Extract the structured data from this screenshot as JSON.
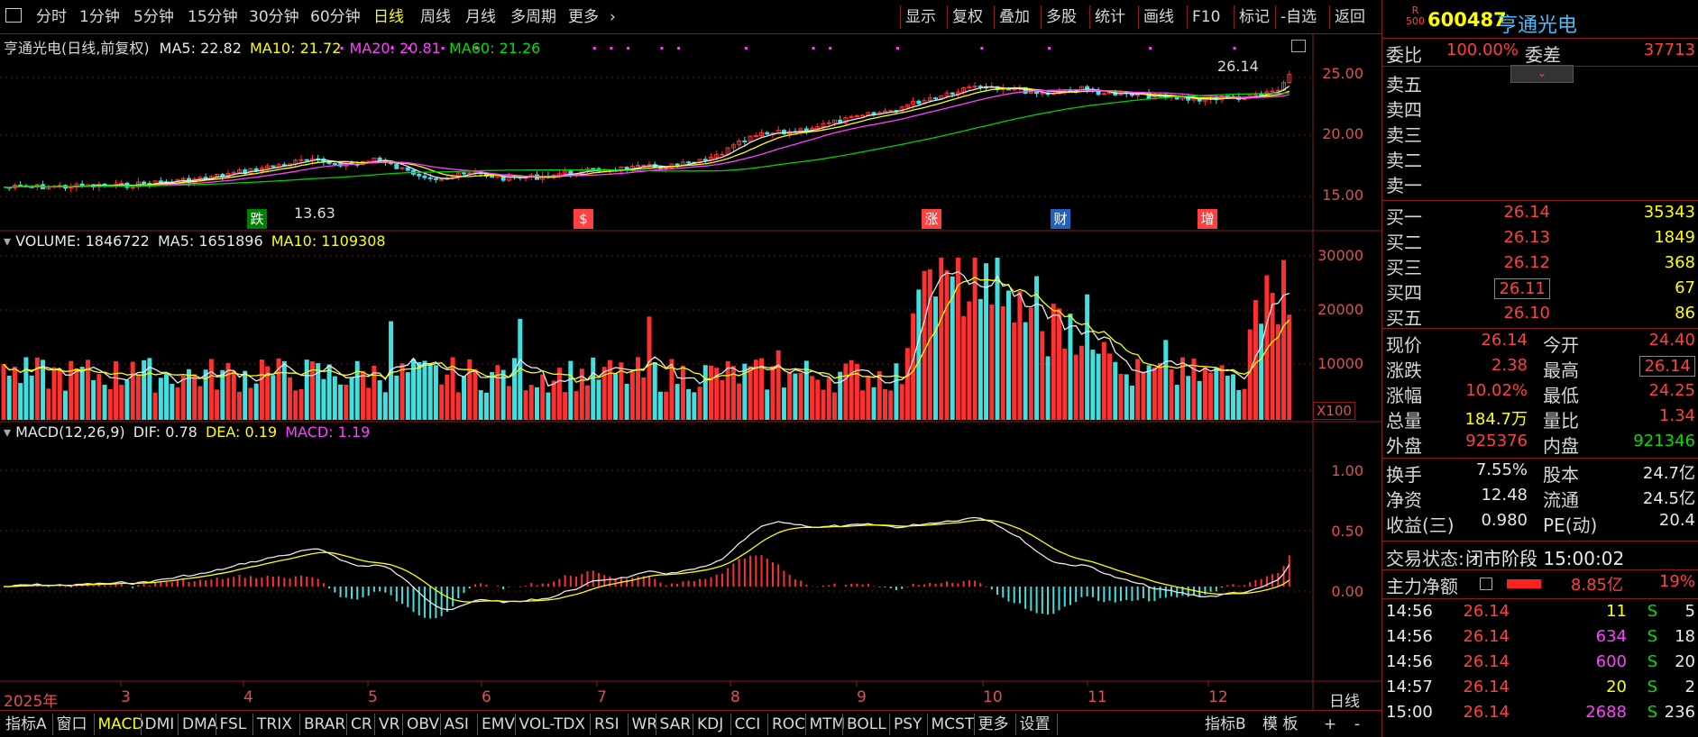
{
  "toolbar": {
    "periods": [
      "分时",
      "1分钟",
      "5分钟",
      "15分钟",
      "30分钟",
      "60分钟",
      "日线",
      "周线",
      "月线",
      "多周期",
      "更多"
    ],
    "active_period": "日线",
    "more_arrow": "›",
    "right_buttons": [
      "显示",
      "复权",
      "叠加",
      "多股",
      "统计",
      "画线",
      "F10",
      "标记",
      "-自选",
      "返回"
    ]
  },
  "main_chart": {
    "caption_name": "亨通光电(日线,前复权)",
    "ma5": "MA5: 22.82",
    "ma10": "MA10: 21.72",
    "ma20": "MA20: 20.81",
    "ma60": "MA60: 21.26",
    "high_marker": "26.14",
    "low_marker": "13.63",
    "y_ticks": [
      "25.00",
      "20.00",
      "15.00"
    ],
    "events": [
      {
        "label": "跌",
        "color": "#008000"
      },
      {
        "label": "$",
        "color": "#ff4040"
      },
      {
        "label": "涨",
        "color": "#ff4040"
      },
      {
        "label": "财",
        "color": "#2060c0"
      },
      {
        "label": "增",
        "color": "#ff4040"
      }
    ]
  },
  "volume_chart": {
    "caption_volume": "VOLUME: 1846722",
    "caption_ma5": "MA5: 1651896",
    "caption_ma10": "MA10: 1109308",
    "y_ticks": [
      "30000",
      "20000",
      "10000"
    ],
    "unit": "X100"
  },
  "macd_chart": {
    "caption_name": "MACD(12,26,9)",
    "dif": "DIF: 0.78",
    "dea": "DEA: 0.19",
    "macd": "MACD: 1.19",
    "y_ticks": [
      "1.00",
      "0.50",
      "0.00"
    ]
  },
  "time_axis": {
    "labels": [
      "2025年",
      "3",
      "4",
      "5",
      "6",
      "7",
      "8",
      "9",
      "10",
      "11",
      "12"
    ],
    "period_label": "日线"
  },
  "bottom_tabs": {
    "items": [
      "指标A",
      "窗口",
      "MACD",
      "DMI",
      "DMA",
      "FSL",
      "TRIX",
      "BRAR",
      "CR",
      "VR",
      "OBV",
      "ASI",
      "EMV",
      "VOL-TDX",
      "RSI",
      "WR",
      "SAR",
      "KDJ",
      "CCI",
      "ROC",
      "MTM",
      "BOLL",
      "PSY",
      "MCST",
      "更多",
      "设置"
    ],
    "active": "MACD",
    "right_items": [
      "指标B",
      "模 板",
      "+",
      "-"
    ]
  },
  "quote_panel": {
    "badge_top": "R",
    "badge_bottom": "500",
    "code": "600487",
    "name": "亨通光电",
    "weibi_label": "委比",
    "weibi_value": "100.00%",
    "weicha_label": "委差",
    "weicha_value": "37713",
    "sell_labels": [
      "卖五",
      "卖四",
      "卖三",
      "卖二",
      "卖一"
    ],
    "buy": [
      {
        "label": "买一",
        "price": "26.14",
        "vol": "35343"
      },
      {
        "label": "买二",
        "price": "26.13",
        "vol": "1849"
      },
      {
        "label": "买三",
        "price": "26.12",
        "vol": "368"
      },
      {
        "label": "买四",
        "price": "26.11",
        "vol": "67"
      },
      {
        "label": "买五",
        "price": "26.10",
        "vol": "86"
      }
    ],
    "stats": [
      {
        "l1": "现价",
        "v1": "26.14",
        "l2": "今开",
        "v2": "24.40"
      },
      {
        "l1": "涨跌",
        "v1": "2.38",
        "l2": "最高",
        "v2": "26.14"
      },
      {
        "l1": "涨幅",
        "v1": "10.02%",
        "l2": "最低",
        "v2": "24.25"
      },
      {
        "l1": "总量",
        "v1": "184.7万",
        "l2": "量比",
        "v2": "1.34"
      },
      {
        "l1": "外盘",
        "v1": "925376",
        "l2": "内盘",
        "v2": "921346"
      }
    ],
    "stats2": [
      {
        "l1": "换手",
        "v1": "7.55%",
        "l2": "股本",
        "v2": "24.7亿"
      },
      {
        "l1": "净资",
        "v1": "12.48",
        "l2": "流通",
        "v2": "24.5亿"
      },
      {
        "l1": "收益(三)",
        "v1": "0.980",
        "l2": "PE(动)",
        "v2": "20.4"
      }
    ],
    "trade_state_label": "交易状态:",
    "trade_state_value": "闭市阶段 15:00:02",
    "net_label": "主力净额",
    "net_value": "8.85亿",
    "net_pct": "19%",
    "ticks": [
      {
        "time": "14:56",
        "price": "26.14",
        "vol": "11",
        "side": "S",
        "n": "5",
        "volColor": "#ffff00"
      },
      {
        "time": "14:56",
        "price": "26.14",
        "vol": "634",
        "side": "S",
        "n": "18",
        "volColor": "#ff40ff"
      },
      {
        "time": "14:56",
        "price": "26.14",
        "vol": "600",
        "side": "S",
        "n": "20",
        "volColor": "#ff40ff"
      },
      {
        "time": "14:57",
        "price": "26.14",
        "vol": "20",
        "side": "S",
        "n": "2",
        "volColor": "#ffff00"
      },
      {
        "time": "15:00",
        "price": "26.14",
        "vol": "2688",
        "side": "S",
        "n": "236",
        "volColor": "#ff40ff"
      }
    ]
  }
}
